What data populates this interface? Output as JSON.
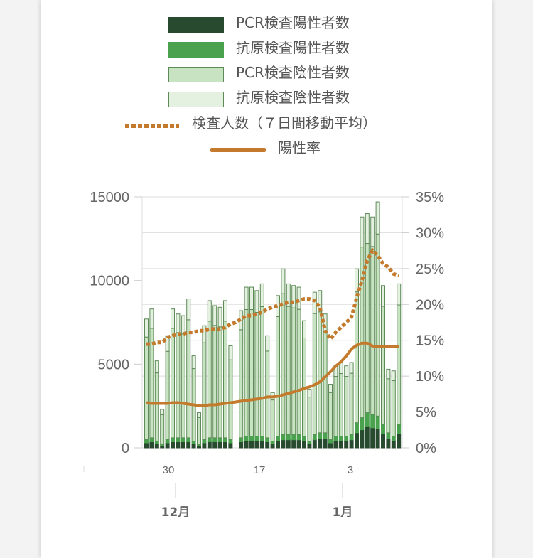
{
  "legend": [
    {
      "label": "PCR検査陽性者数",
      "kind": "box",
      "fill": "#284b30",
      "stroke": "#284b30"
    },
    {
      "label": "抗原検査陽性者数",
      "kind": "box",
      "fill": "#4aa24f",
      "stroke": "#4aa24f"
    },
    {
      "label": "PCR検査陰性者数",
      "kind": "box",
      "fill": "#c7e3c1",
      "stroke": "#5e8a58"
    },
    {
      "label": "抗原検査陰性者数",
      "kind": "box",
      "fill": "#e4f1e0",
      "stroke": "#5e8a58"
    },
    {
      "label": "検査人数（７日間移動平均）",
      "kind": "dotted",
      "color": "#c47a2c"
    },
    {
      "label": "陽性率",
      "kind": "line",
      "color": "#c47a2c"
    }
  ],
  "chart_data": {
    "type": "bar",
    "stacked": true,
    "x_tick_labels": [
      "30",
      "17",
      "3"
    ],
    "x_group_labels": [
      "12月",
      "1月"
    ],
    "y_left": {
      "ticks": [
        "0",
        "5000",
        "10000",
        "15000"
      ],
      "range": [
        0,
        15000
      ]
    },
    "y_right": {
      "ticks": [
        "0%",
        "5%",
        "10%",
        "15%",
        "20%",
        "25%",
        "30%",
        "35%"
      ],
      "range": [
        0,
        35
      ]
    },
    "colors": {
      "pcr_positive": "#284b30",
      "antigen_positive": "#4aa24f",
      "pcr_negative": "#c7e3c1",
      "antigen_negative": "#e4f1e0",
      "bar_stroke": "#5e8a58",
      "line": "#c47a2c",
      "grid": "#dddddd"
    },
    "totals": [
      7700,
      8300,
      5200,
      2300,
      6700,
      8300,
      8000,
      7900,
      8900,
      5500,
      2100,
      7300,
      8800,
      8500,
      8400,
      8800,
      6100,
      0,
      8200,
      9600,
      9600,
      9400,
      9800,
      6700,
      3300,
      9100,
      10700,
      9800,
      9700,
      9600,
      7600,
      3500,
      9300,
      9400,
      8000,
      3800,
      4900,
      5100,
      4900,
      5100,
      10700,
      13800,
      14000,
      13800,
      14700,
      9700,
      4700,
      4600,
      9800
    ],
    "positives": [
      500,
      600,
      400,
      200,
      500,
      600,
      600,
      600,
      600,
      400,
      200,
      500,
      600,
      600,
      600,
      600,
      500,
      0,
      600,
      700,
      700,
      700,
      700,
      600,
      400,
      700,
      800,
      800,
      800,
      800,
      700,
      400,
      800,
      900,
      900,
      500,
      700,
      700,
      700,
      800,
      1500,
      1800,
      2100,
      2000,
      1900,
      1400,
      900,
      700,
      1400
    ],
    "tests_7day_avg": [
      6200,
      6200,
      6300,
      6300,
      6600,
      6700,
      6800,
      6800,
      6900,
      6900,
      7000,
      7000,
      7100,
      7100,
      7100,
      7200,
      7400,
      7500,
      7700,
      7900,
      7900,
      8000,
      8100,
      8300,
      8400,
      8500,
      8600,
      8700,
      8700,
      8800,
      8900,
      8900,
      8800,
      8400,
      7000,
      6500,
      6900,
      7200,
      7500,
      7800,
      9000,
      10000,
      11200,
      11800,
      11500,
      11000,
      10800,
      10400,
      10300
    ],
    "positive_rate_pct": [
      6.3,
      6.2,
      6.2,
      6.2,
      6.2,
      6.3,
      6.3,
      6.2,
      6.1,
      6.0,
      5.9,
      5.9,
      6.0,
      6.0,
      6.1,
      6.2,
      6.3,
      6.4,
      6.5,
      6.6,
      6.7,
      6.8,
      6.9,
      7.1,
      7.1,
      7.2,
      7.4,
      7.6,
      7.8,
      8.0,
      8.3,
      8.5,
      8.8,
      9.2,
      9.9,
      10.6,
      11.4,
      12.0,
      12.8,
      13.8,
      14.3,
      14.6,
      14.6,
      14.2,
      14.1,
      14.1,
      14.1,
      14.1,
      14.1
    ]
  }
}
